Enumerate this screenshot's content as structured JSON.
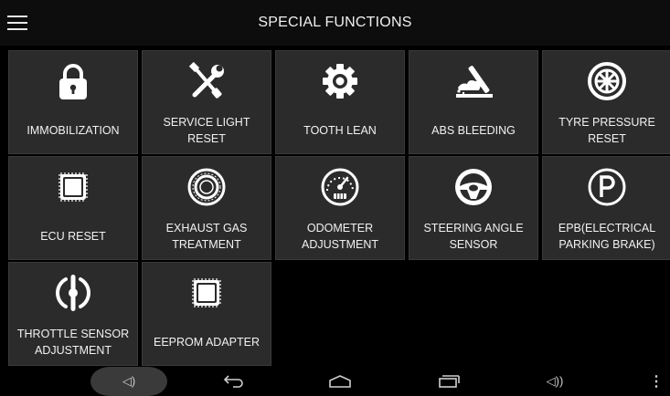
{
  "header": {
    "title": "SPECIAL FUNCTIONS",
    "menu_icon": "hamburger-menu-icon"
  },
  "tiles": [
    {
      "label": "IMMOBILIZATION",
      "icon": "lock-icon"
    },
    {
      "label": "SERVICE LIGHT\nRESET",
      "icon": "tools-icon"
    },
    {
      "label": "TOOTH LEAN",
      "icon": "gear-icon"
    },
    {
      "label": "ABS BLEEDING",
      "icon": "brake-pedal-icon"
    },
    {
      "label": "TYRE PRESSURE\nRESET",
      "icon": "tyre-icon"
    },
    {
      "label": "ECU RESET",
      "icon": "chip-icon"
    },
    {
      "label": "EXHAUST GAS\nTREATMENT",
      "icon": "exhaust-filter-icon"
    },
    {
      "label": "ODOMETER\nADJUSTMENT",
      "icon": "speedometer-icon"
    },
    {
      "label": "STEERING ANGLE\nSENSOR",
      "icon": "steering-wheel-icon"
    },
    {
      "label": "EPB(ELECTRICAL\nPARKING BRAKE)",
      "icon": "parking-brake-icon"
    },
    {
      "label": "THROTTLE SENSOR\nADJUSTMENT",
      "icon": "throttle-sensor-icon"
    },
    {
      "label": "EEPROM ADAPTER",
      "icon": "eeprom-chip-icon"
    }
  ],
  "navbar": {
    "volume_down_label": "◁)",
    "volume_up_label": "◁))",
    "more_label": "⋮"
  },
  "colors": {
    "tile_bg": "#2b2b2b",
    "header_bg": "#0d0d0d",
    "background": "#000000"
  }
}
